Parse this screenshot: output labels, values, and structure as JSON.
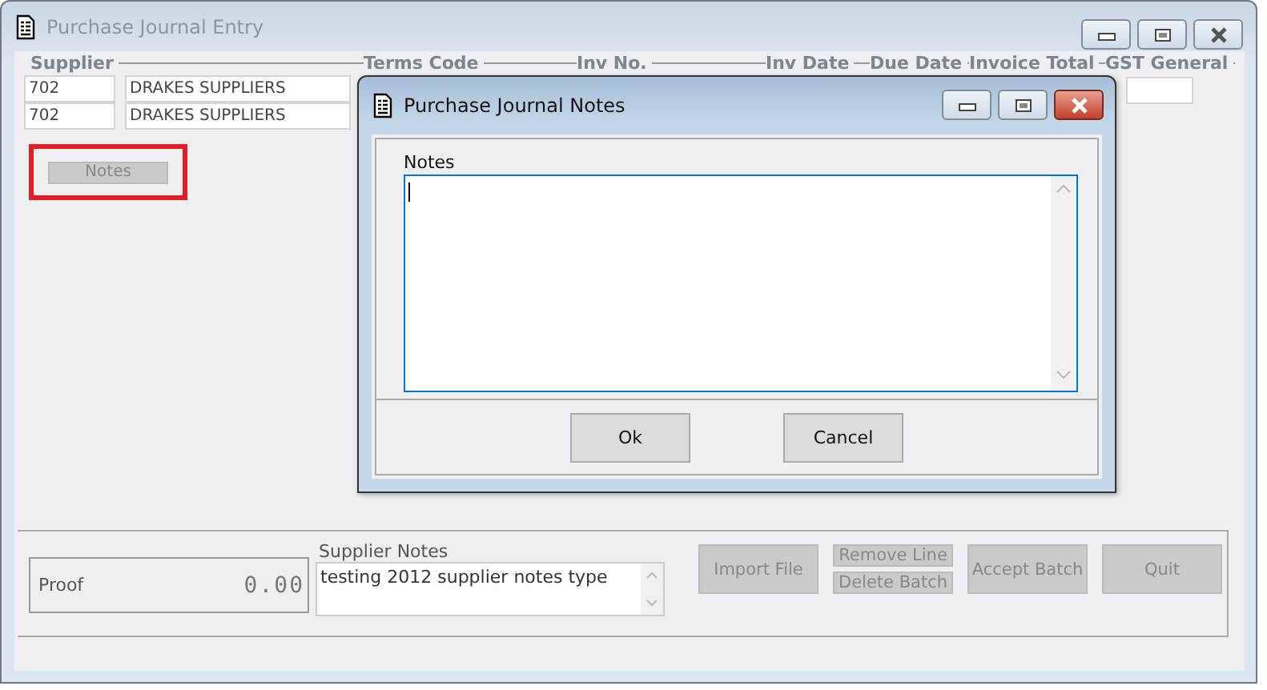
{
  "window": {
    "title": "Purchase Journal Entry",
    "active": false
  },
  "columns": [
    "Supplier",
    "Terms Code",
    "Inv No.",
    "Inv Date",
    "Due Date",
    "Invoice Total",
    "GST General"
  ],
  "rows": [
    {
      "code": "702",
      "name": "DRAKES SUPPLIERS"
    },
    {
      "code": "702",
      "name": "DRAKES SUPPLIERS"
    }
  ],
  "notes_button": {
    "label": "Notes",
    "disabled": true,
    "highlighted": true
  },
  "proof": {
    "label": "Proof",
    "value": "0.00"
  },
  "supplier_notes": {
    "label": "Supplier Notes",
    "value": "testing 2012 supplier notes type"
  },
  "buttons": [
    {
      "kind": "large",
      "label": "Import File",
      "disabled": true
    },
    {
      "kind": "stack",
      "items": [
        {
          "label": "Remove Line",
          "disabled": true
        },
        {
          "label": "Delete Batch",
          "disabled": true
        }
      ]
    },
    {
      "kind": "large",
      "label": "Accept Batch",
      "disabled": true
    },
    {
      "kind": "large",
      "label": "Quit",
      "disabled": true
    }
  ],
  "dialog": {
    "title": "Purchase Journal Notes",
    "active": true,
    "field_label": "Notes",
    "buttons": [
      {
        "label": "Ok"
      },
      {
        "label": "Cancel"
      }
    ]
  }
}
